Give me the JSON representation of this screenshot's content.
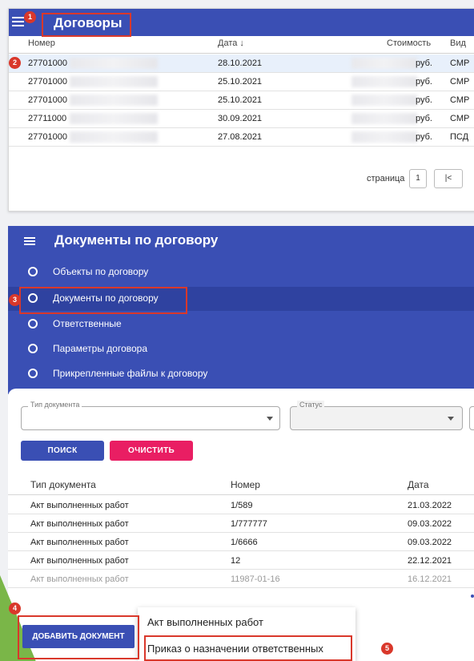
{
  "contracts": {
    "title": "Договоры",
    "columns": [
      "Номер",
      "Дата ↓",
      "Стоимость",
      "Вид"
    ],
    "rows": [
      {
        "number": "27701000",
        "date": "28.10.2021",
        "currency": "руб.",
        "kind": "СМР"
      },
      {
        "number": "27701000",
        "date": "25.10.2021",
        "currency": "руб.",
        "kind": "СМР"
      },
      {
        "number": "27701000",
        "date": "25.10.2021",
        "currency": "руб.",
        "kind": "СМР"
      },
      {
        "number": "27711000",
        "date": "30.09.2021",
        "currency": "руб.",
        "kind": "СМР"
      },
      {
        "number": "27701000",
        "date": "27.08.2021",
        "currency": "руб.",
        "kind": "ПСД"
      }
    ],
    "pager": {
      "label": "страница",
      "page": "1",
      "first": "|<"
    }
  },
  "documents_panel": {
    "title": "Документы по договору",
    "nav": [
      {
        "label": "Объекты по договору"
      },
      {
        "label": "Документы по договору"
      },
      {
        "label": "Ответственные"
      },
      {
        "label": "Параметры договора"
      },
      {
        "label": "Прикрепленные файлы к договору"
      }
    ]
  },
  "filters": {
    "doc_type_label": "Тип документа",
    "status_label": "Статус",
    "search_label": "ПОИСК",
    "clear_label": "ОЧИСТИТЬ"
  },
  "documents": {
    "columns": [
      "Тип документа",
      "Номер",
      "Дата"
    ],
    "rows": [
      {
        "type": "Акт выполненных работ",
        "number": "1/589",
        "date": "21.03.2022"
      },
      {
        "type": "Акт выполненных работ",
        "number": "1/777777",
        "date": "09.03.2022"
      },
      {
        "type": "Акт выполненных работ",
        "number": "1/6666",
        "date": "09.03.2022"
      },
      {
        "type": "Акт выполненных работ",
        "number": "12",
        "date": "22.12.2021"
      },
      {
        "type": "Акт выполненных работ",
        "number": "11987-01-16",
        "date": "16.12.2021"
      }
    ]
  },
  "add_document": {
    "label": "ДОБАВИТЬ ДОКУМЕНТ",
    "menu": [
      "Акт выполненных работ",
      "Приказ о назначении ответственных"
    ]
  },
  "callouts": [
    "1",
    "2",
    "3",
    "4",
    "5"
  ],
  "colors": {
    "primary": "#3a4fb4",
    "accent": "#e91e63",
    "callout": "#d9382b",
    "highlight_row": "#e8f0fb"
  }
}
